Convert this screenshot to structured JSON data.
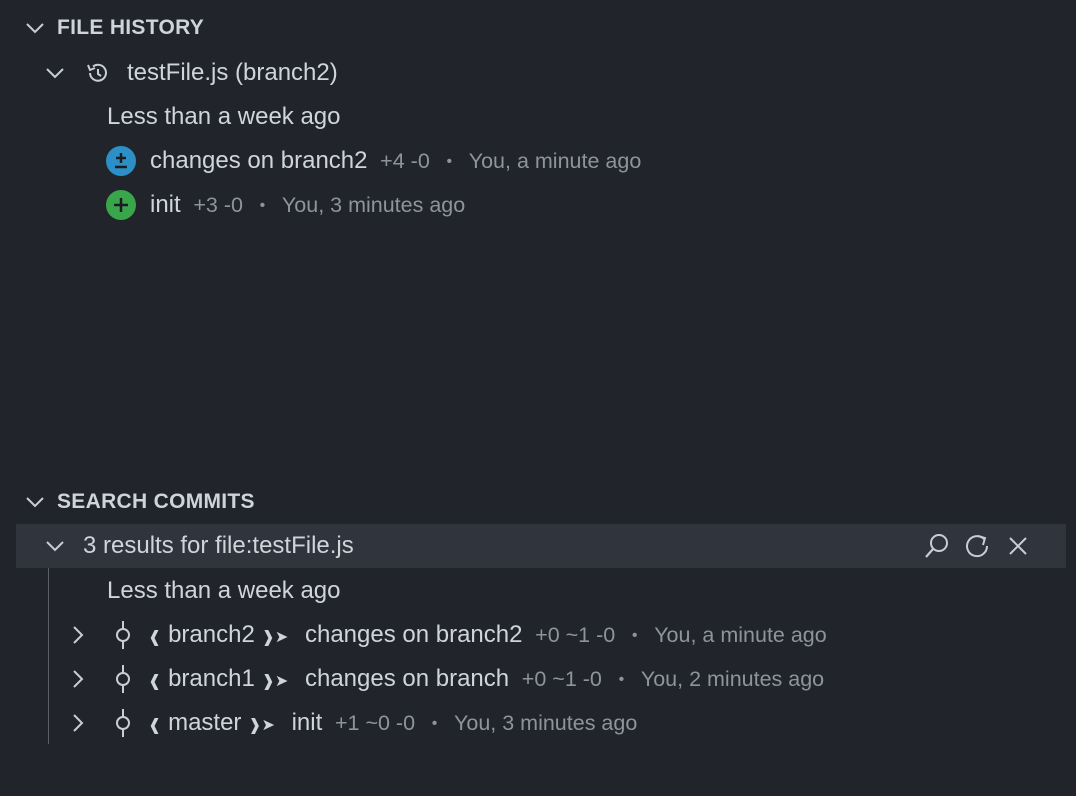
{
  "file_history": {
    "title": "FILE HISTORY",
    "file_label": "testFile.js (branch2)",
    "group_label": "Less than a week ago",
    "commits": [
      {
        "message": "changes on branch2",
        "stats": "+4 -0",
        "meta": "You, a minute ago",
        "icon": "modified-icon",
        "color": "#2d8fc8"
      },
      {
        "message": "init",
        "stats": "+3 -0",
        "meta": "You, 3 minutes ago",
        "icon": "added-icon",
        "color": "#3aa64b"
      }
    ]
  },
  "search_commits": {
    "title": "SEARCH COMMITS",
    "results_label": "3 results for file:testFile.js",
    "group_label": "Less than a week ago",
    "actions": [
      "search-icon",
      "refresh-icon",
      "close-icon"
    ],
    "commits": [
      {
        "branch": "branch2",
        "message": "changes on branch2",
        "stats": "+0 ~1 -0",
        "meta": "You, a minute ago"
      },
      {
        "branch": "branch1",
        "message": "changes on branch",
        "stats": "+0 ~1 -0",
        "meta": "You, 2 minutes ago"
      },
      {
        "branch": "master",
        "message": "init",
        "stats": "+1 ~0 -0",
        "meta": "You, 3 minutes ago"
      }
    ]
  },
  "symbols": {
    "separator": "•",
    "bracket_open": "❰",
    "bracket_close": "❱➤"
  },
  "colors": {
    "background": "#21252b",
    "selected_row": "#2f343d",
    "modified": "#2d8fc8",
    "added": "#3aa64b"
  }
}
